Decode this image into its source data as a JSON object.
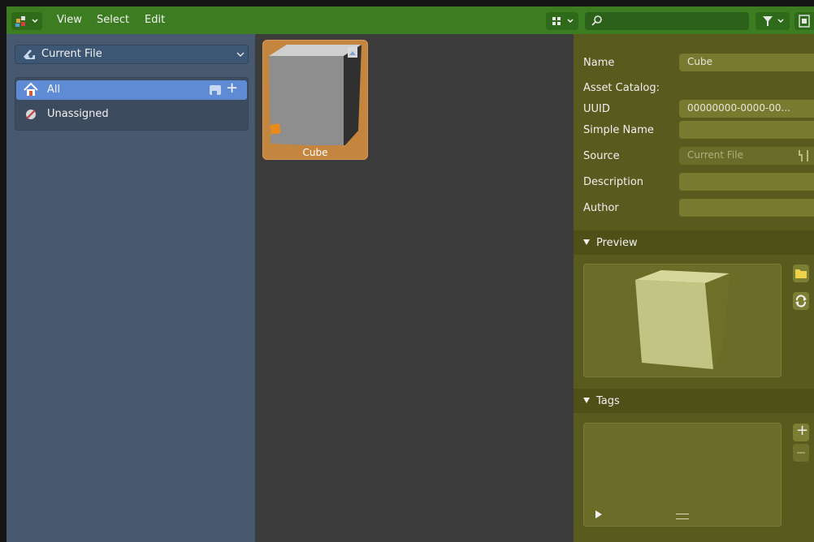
{
  "header": {
    "menus": [
      "View",
      "Select",
      "Edit"
    ],
    "search_placeholder": ""
  },
  "left_panel": {
    "library_select": "Current File",
    "catalogs": [
      {
        "label": "All",
        "selected": true
      },
      {
        "label": "Unassigned",
        "selected": false
      }
    ]
  },
  "assets": [
    {
      "label": "Cube"
    }
  ],
  "properties": {
    "fields": [
      {
        "label": "Name",
        "value": "Cube"
      },
      {
        "label": "Asset Catalog:",
        "value": ""
      },
      {
        "label": "UUID",
        "value": "00000000-0000-00..."
      },
      {
        "label": "Simple Name",
        "value": ""
      },
      {
        "label": "Source",
        "value": "Current File"
      },
      {
        "label": "Description",
        "value": ""
      },
      {
        "label": "Author",
        "value": ""
      }
    ],
    "preview_title": "Preview",
    "tags_title": "Tags"
  },
  "colors": {
    "header": "#3d7d22",
    "left_panel": "#48586e",
    "selected_row": "#5f8bd5",
    "browser_bg": "#3c3c3c",
    "asset_tile": "#c4853e",
    "sidebar": "#595a1d",
    "field": "#787a2f"
  }
}
